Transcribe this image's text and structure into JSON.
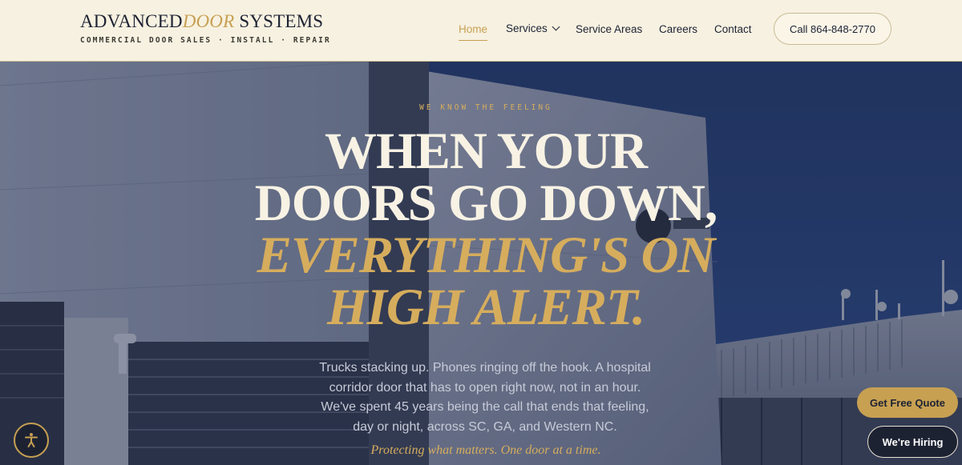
{
  "brand": {
    "name_part1": "ADVANCED",
    "name_part2": "DOOR",
    "name_part3": " SYSTEMS",
    "tagline": "COMMERCIAL DOOR SALES · INSTALL · REPAIR"
  },
  "nav": {
    "items": [
      {
        "label": "Home",
        "active": true
      },
      {
        "label": "Services",
        "has_dropdown": true
      },
      {
        "label": "Service Areas"
      },
      {
        "label": "Careers"
      },
      {
        "label": "Contact"
      }
    ],
    "call_button": "Call 864-848-2770"
  },
  "hero": {
    "eyebrow": "WE KNOW THE FEELING",
    "headline_lines": [
      "WHEN YOUR",
      "DOORS GO DOWN,"
    ],
    "headline_accent_lines": [
      "EVERYTHING'S ON",
      "HIGH ALERT."
    ],
    "body": "Trucks stacking up. Phones ringing off the hook. A hospital corridor door that has to open right now, not in an hour. We've spent 45 years being the call that ends that feeling, day or night, across SC, GA, and Western NC.",
    "tagline": "Protecting what matters. One door at a time."
  },
  "floating": {
    "quote_button": "Get Free Quote",
    "hiring_button": "We're Hiring",
    "accessibility_icon": "accessibility-icon"
  },
  "colors": {
    "cream": "#f7f1e1",
    "navy": "#1d2233",
    "gold": "#c7a052",
    "sky": "#2c3f6e"
  }
}
